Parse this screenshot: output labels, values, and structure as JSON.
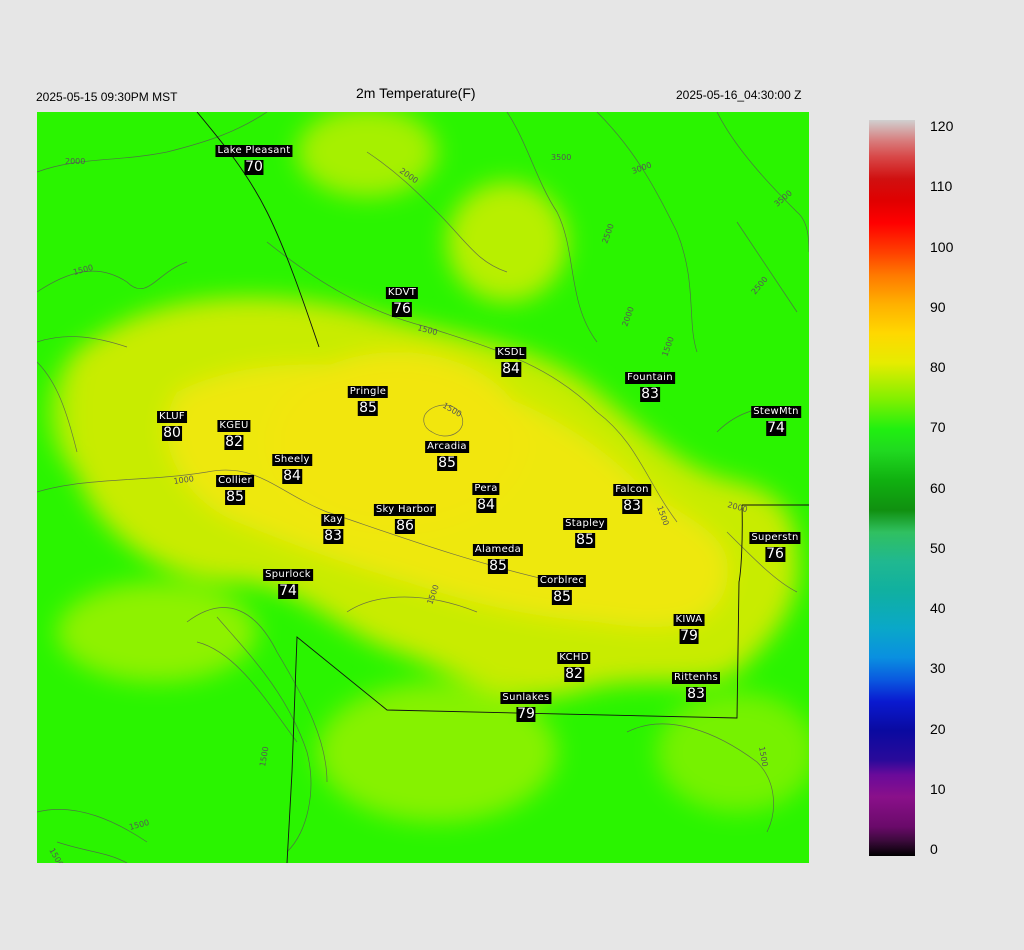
{
  "header": {
    "title": "2m Temperature(F)",
    "local_time": "2025-05-15 09:30PM MST",
    "utc_time": "2025-05-16_04:30:00 Z"
  },
  "stations": [
    {
      "name": "Lake Pleasant",
      "value": "70"
    },
    {
      "name": "KDVT",
      "value": "76"
    },
    {
      "name": "KSDL",
      "value": "84"
    },
    {
      "name": "Fountain",
      "value": "83"
    },
    {
      "name": "Pringle",
      "value": "85"
    },
    {
      "name": "StewMtn",
      "value": "74"
    },
    {
      "name": "KLUF",
      "value": "80"
    },
    {
      "name": "KGEU",
      "value": "82"
    },
    {
      "name": "Arcadia",
      "value": "85"
    },
    {
      "name": "Sheely",
      "value": "84"
    },
    {
      "name": "Collier",
      "value": "85"
    },
    {
      "name": "Pera",
      "value": "84"
    },
    {
      "name": "Falcon",
      "value": "83"
    },
    {
      "name": "Kay",
      "value": "83"
    },
    {
      "name": "Sky Harbor",
      "value": "86"
    },
    {
      "name": "Stapley",
      "value": "85"
    },
    {
      "name": "Superstn",
      "value": "76"
    },
    {
      "name": "Alameda",
      "value": "85"
    },
    {
      "name": "Spurlock",
      "value": "74"
    },
    {
      "name": "Corblrec",
      "value": "85"
    },
    {
      "name": "KIWA",
      "value": "79"
    },
    {
      "name": "KCHD",
      "value": "82"
    },
    {
      "name": "Rittenhs",
      "value": "83"
    },
    {
      "name": "Sunlakes",
      "value": "79"
    }
  ],
  "contour_labels": [
    "2000",
    "2000",
    "3500",
    "3000",
    "3500",
    "2500",
    "2000",
    "2500",
    "1500",
    "1500",
    "1500",
    "1500",
    "1000",
    "1500",
    "2000",
    "1500",
    "1500",
    "1500",
    "1500",
    "1500"
  ],
  "colorbar": {
    "ticks": [
      "120",
      "110",
      "100",
      "90",
      "80",
      "70",
      "60",
      "50",
      "40",
      "30",
      "20",
      "10",
      "0"
    ],
    "min": 0,
    "max": 120
  },
  "colors": {
    "background": "#e6e6e6",
    "warm_yellow": "#f0e80c",
    "green": "#22f400"
  }
}
